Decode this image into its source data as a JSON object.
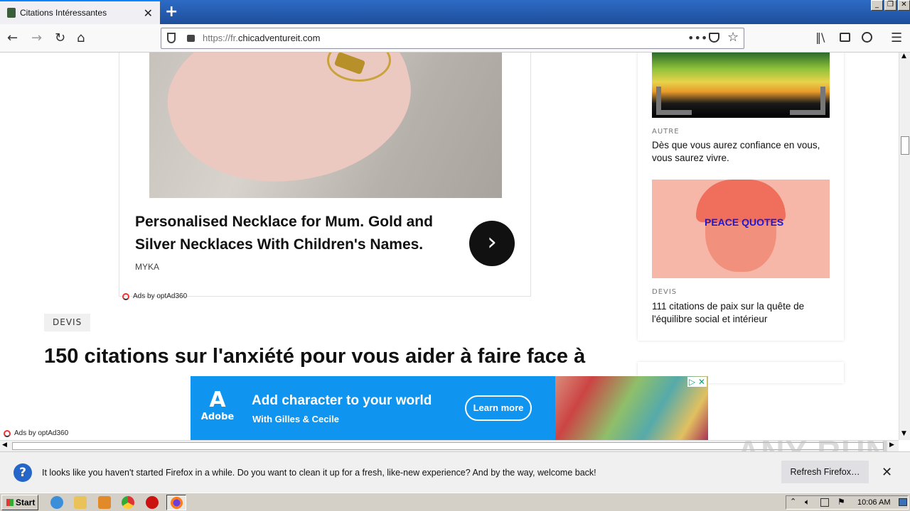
{
  "browser": {
    "tab_title": "Citations Intéressantes",
    "url_prefix": "https://fr.",
    "url_domain": "chicadventureit.com"
  },
  "ad_card": {
    "title": "Personalised Necklace for Mum. Gold and Silver Necklaces With Children's Names.",
    "source": "MYKA",
    "ads_by": "Ads by optAd360"
  },
  "article": {
    "tag": "DEVIS",
    "headline": "150 citations sur l'anxiété pour vous aider à faire face à"
  },
  "sidebar": {
    "items": [
      {
        "category": "AUTRE",
        "title": "Dès que vous aurez confiance en vous, vous saurez vivre."
      },
      {
        "category": "DEVIS",
        "title": "111 citations de paix sur la quête de l'équilibre social et intérieur",
        "image_text": "PEACE QUOTES"
      }
    ]
  },
  "bottom_ad": {
    "brand": "Adobe",
    "title": "Add character to your world",
    "subtitle": "With Gilles & Cecile",
    "button": "Learn more",
    "ads_by": "Ads by optAd360"
  },
  "notification": {
    "text": "It looks like you haven't started Firefox in a while. Do you want to clean it up for a fresh, like-new experience? And by the way, welcome back!",
    "button": "Refresh Firefox…"
  },
  "taskbar": {
    "start": "Start",
    "clock": "10:06 AM"
  },
  "watermark": "ANY RUN"
}
